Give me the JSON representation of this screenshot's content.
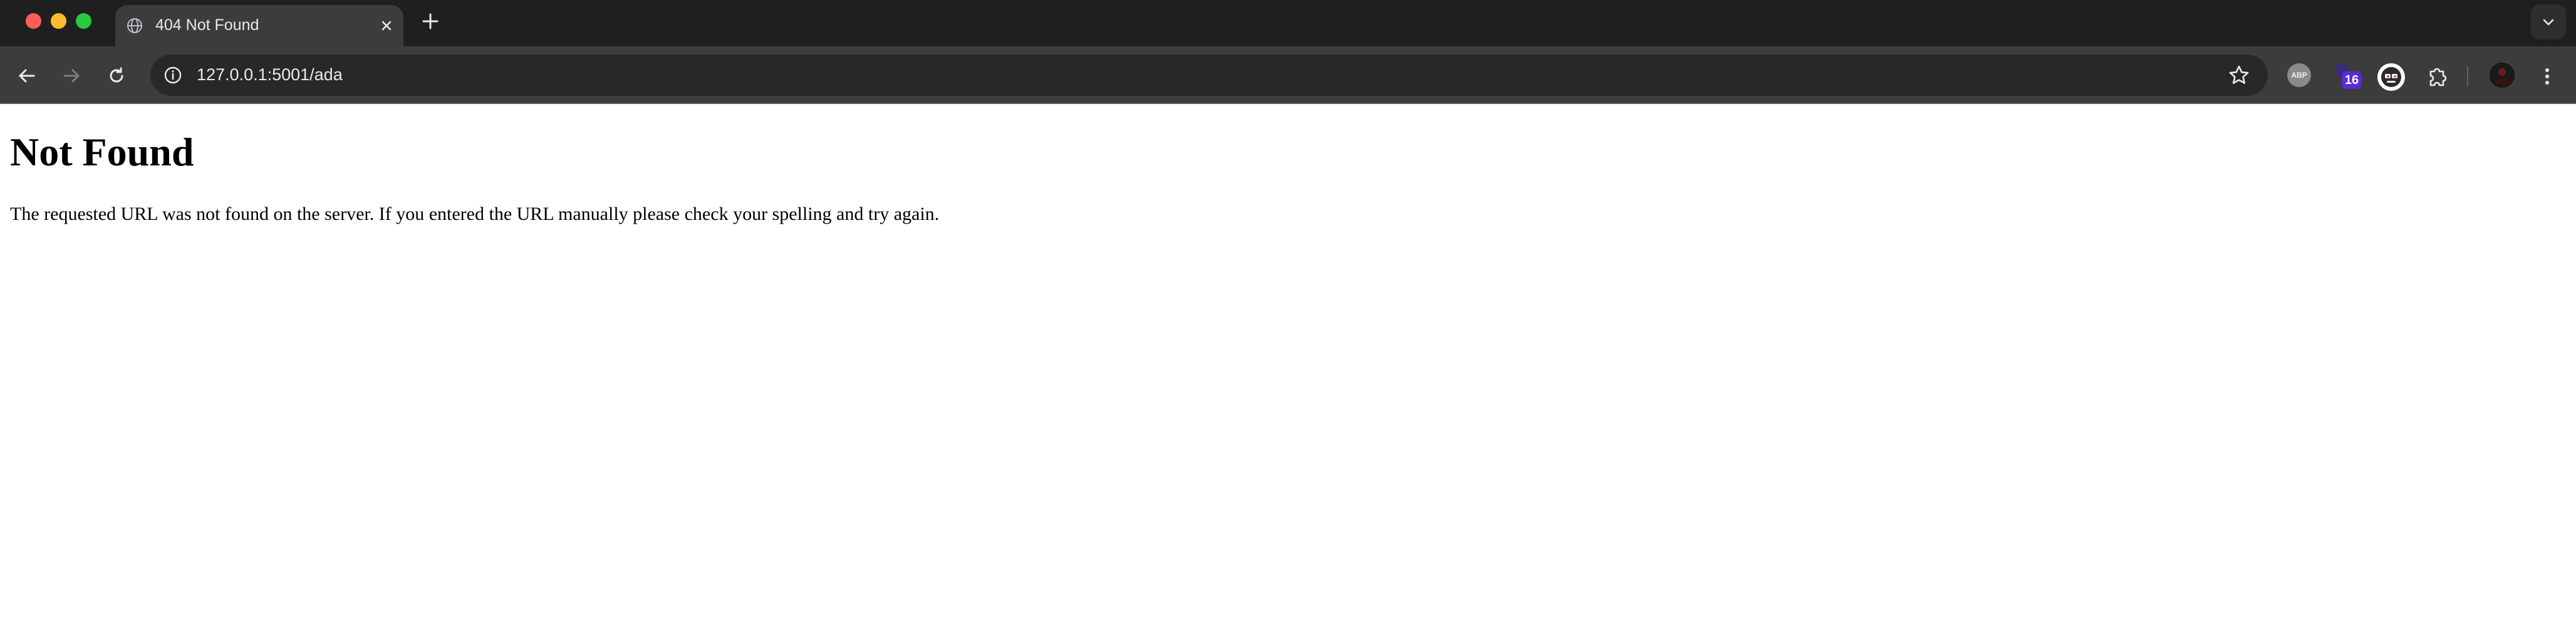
{
  "browser": {
    "tab": {
      "title": "404 Not Found"
    },
    "address_bar": {
      "url": "127.0.0.1:5001/ada"
    },
    "extensions": {
      "adblock_label": "ABP",
      "badge_count": "16"
    },
    "colors": {
      "tab_strip": "#1f1f1f",
      "toolbar": "#3c3c3c",
      "omnibox": "#282828",
      "badge": "#5a2bd6"
    }
  },
  "page": {
    "heading": "Not Found",
    "message": "The requested URL was not found on the server. If you entered the URL manually please check your spelling and try again."
  }
}
